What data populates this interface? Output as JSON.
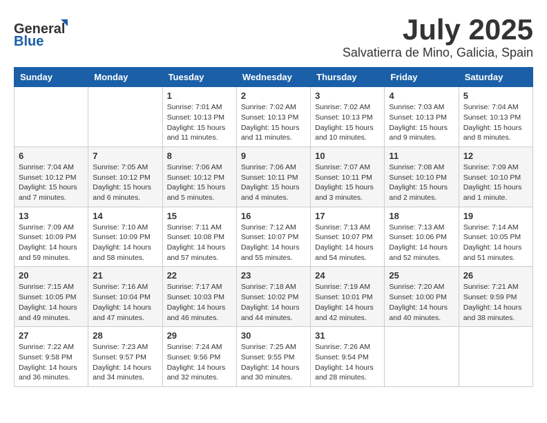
{
  "logo": {
    "text_general": "General",
    "text_blue": "Blue"
  },
  "header": {
    "month": "July 2025",
    "location": "Salvatierra de Mino, Galicia, Spain"
  },
  "days_of_week": [
    "Sunday",
    "Monday",
    "Tuesday",
    "Wednesday",
    "Thursday",
    "Friday",
    "Saturday"
  ],
  "weeks": [
    [
      {
        "day": "",
        "info": ""
      },
      {
        "day": "",
        "info": ""
      },
      {
        "day": "1",
        "info": "Sunrise: 7:01 AM\nSunset: 10:13 PM\nDaylight: 15 hours and 11 minutes."
      },
      {
        "day": "2",
        "info": "Sunrise: 7:02 AM\nSunset: 10:13 PM\nDaylight: 15 hours and 11 minutes."
      },
      {
        "day": "3",
        "info": "Sunrise: 7:02 AM\nSunset: 10:13 PM\nDaylight: 15 hours and 10 minutes."
      },
      {
        "day": "4",
        "info": "Sunrise: 7:03 AM\nSunset: 10:13 PM\nDaylight: 15 hours and 9 minutes."
      },
      {
        "day": "5",
        "info": "Sunrise: 7:04 AM\nSunset: 10:13 PM\nDaylight: 15 hours and 8 minutes."
      }
    ],
    [
      {
        "day": "6",
        "info": "Sunrise: 7:04 AM\nSunset: 10:12 PM\nDaylight: 15 hours and 7 minutes."
      },
      {
        "day": "7",
        "info": "Sunrise: 7:05 AM\nSunset: 10:12 PM\nDaylight: 15 hours and 6 minutes."
      },
      {
        "day": "8",
        "info": "Sunrise: 7:06 AM\nSunset: 10:12 PM\nDaylight: 15 hours and 5 minutes."
      },
      {
        "day": "9",
        "info": "Sunrise: 7:06 AM\nSunset: 10:11 PM\nDaylight: 15 hours and 4 minutes."
      },
      {
        "day": "10",
        "info": "Sunrise: 7:07 AM\nSunset: 10:11 PM\nDaylight: 15 hours and 3 minutes."
      },
      {
        "day": "11",
        "info": "Sunrise: 7:08 AM\nSunset: 10:10 PM\nDaylight: 15 hours and 2 minutes."
      },
      {
        "day": "12",
        "info": "Sunrise: 7:09 AM\nSunset: 10:10 PM\nDaylight: 15 hours and 1 minute."
      }
    ],
    [
      {
        "day": "13",
        "info": "Sunrise: 7:09 AM\nSunset: 10:09 PM\nDaylight: 14 hours and 59 minutes."
      },
      {
        "day": "14",
        "info": "Sunrise: 7:10 AM\nSunset: 10:09 PM\nDaylight: 14 hours and 58 minutes."
      },
      {
        "day": "15",
        "info": "Sunrise: 7:11 AM\nSunset: 10:08 PM\nDaylight: 14 hours and 57 minutes."
      },
      {
        "day": "16",
        "info": "Sunrise: 7:12 AM\nSunset: 10:07 PM\nDaylight: 14 hours and 55 minutes."
      },
      {
        "day": "17",
        "info": "Sunrise: 7:13 AM\nSunset: 10:07 PM\nDaylight: 14 hours and 54 minutes."
      },
      {
        "day": "18",
        "info": "Sunrise: 7:13 AM\nSunset: 10:06 PM\nDaylight: 14 hours and 52 minutes."
      },
      {
        "day": "19",
        "info": "Sunrise: 7:14 AM\nSunset: 10:05 PM\nDaylight: 14 hours and 51 minutes."
      }
    ],
    [
      {
        "day": "20",
        "info": "Sunrise: 7:15 AM\nSunset: 10:05 PM\nDaylight: 14 hours and 49 minutes."
      },
      {
        "day": "21",
        "info": "Sunrise: 7:16 AM\nSunset: 10:04 PM\nDaylight: 14 hours and 47 minutes."
      },
      {
        "day": "22",
        "info": "Sunrise: 7:17 AM\nSunset: 10:03 PM\nDaylight: 14 hours and 46 minutes."
      },
      {
        "day": "23",
        "info": "Sunrise: 7:18 AM\nSunset: 10:02 PM\nDaylight: 14 hours and 44 minutes."
      },
      {
        "day": "24",
        "info": "Sunrise: 7:19 AM\nSunset: 10:01 PM\nDaylight: 14 hours and 42 minutes."
      },
      {
        "day": "25",
        "info": "Sunrise: 7:20 AM\nSunset: 10:00 PM\nDaylight: 14 hours and 40 minutes."
      },
      {
        "day": "26",
        "info": "Sunrise: 7:21 AM\nSunset: 9:59 PM\nDaylight: 14 hours and 38 minutes."
      }
    ],
    [
      {
        "day": "27",
        "info": "Sunrise: 7:22 AM\nSunset: 9:58 PM\nDaylight: 14 hours and 36 minutes."
      },
      {
        "day": "28",
        "info": "Sunrise: 7:23 AM\nSunset: 9:57 PM\nDaylight: 14 hours and 34 minutes."
      },
      {
        "day": "29",
        "info": "Sunrise: 7:24 AM\nSunset: 9:56 PM\nDaylight: 14 hours and 32 minutes."
      },
      {
        "day": "30",
        "info": "Sunrise: 7:25 AM\nSunset: 9:55 PM\nDaylight: 14 hours and 30 minutes."
      },
      {
        "day": "31",
        "info": "Sunrise: 7:26 AM\nSunset: 9:54 PM\nDaylight: 14 hours and 28 minutes."
      },
      {
        "day": "",
        "info": ""
      },
      {
        "day": "",
        "info": ""
      }
    ]
  ]
}
